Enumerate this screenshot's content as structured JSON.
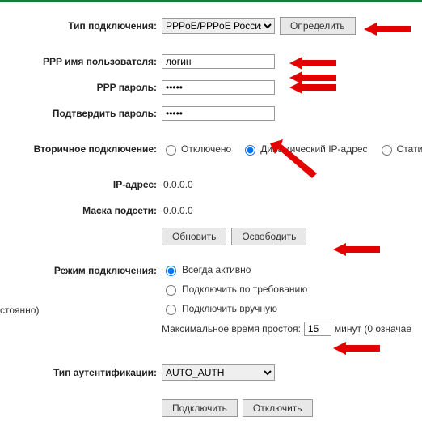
{
  "labels": {
    "conn_type": "Тип подключения:",
    "ppp_user": "PPP имя пользователя:",
    "ppp_pass": "PPP пароль:",
    "ppp_pass2": "Подтвердить пароль:",
    "secondary": "Вторичное подключение:",
    "ip": "IP-адрес:",
    "mask": "Маска подсети:",
    "mode": "Режим подключения:",
    "idle": "Максимальное время простоя:",
    "idle_suffix": "минут (0 означае",
    "auth": "Тип аутентификации:"
  },
  "left_fragment": "стоянно)",
  "values": {
    "conn_type": "PPPoE/PPPoE Россия",
    "ppp_user": "логин",
    "ppp_pass": "•••••",
    "ppp_pass2": "•••••",
    "ip": "0.0.0.0",
    "mask": "0.0.0.0",
    "idle": "15",
    "auth": "AUTO_AUTH"
  },
  "buttons": {
    "detect": "Определить",
    "renew": "Обновить",
    "release": "Освободить",
    "connect": "Подключить",
    "disconnect": "Отключить"
  },
  "radios": {
    "secondary": {
      "off": "Отключено",
      "dynamic": "Динамический IP-адрес",
      "static": "Статиче"
    },
    "mode": {
      "always": "Всегда активно",
      "ondemand": "Подключить по требованию",
      "manual": "Подключить вручную"
    }
  }
}
